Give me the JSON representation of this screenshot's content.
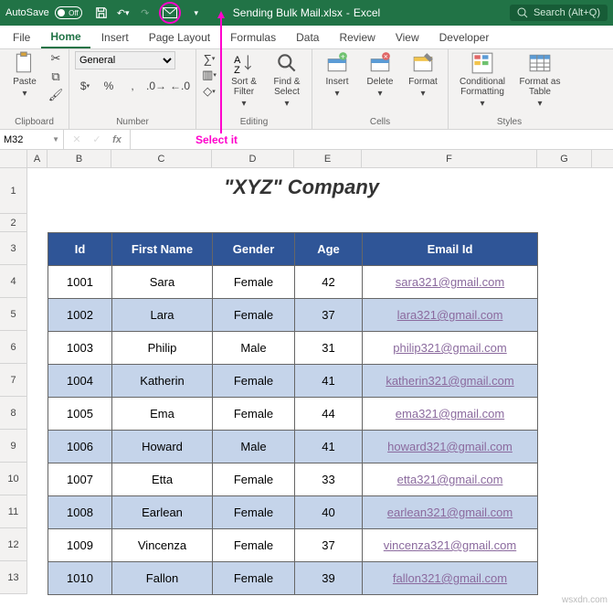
{
  "titlebar": {
    "autosave_label": "AutoSave",
    "autosave_state": "Off",
    "filename": "Sending Bulk Mail.xlsx",
    "app": "Excel",
    "search_placeholder": "Search (Alt+Q)"
  },
  "tabs": [
    "File",
    "Home",
    "Insert",
    "Page Layout",
    "Formulas",
    "Data",
    "Review",
    "View",
    "Developer"
  ],
  "active_tab": "Home",
  "ribbon": {
    "clipboard": {
      "paste": "Paste",
      "group": "Clipboard"
    },
    "number": {
      "format": "General",
      "group": "Number"
    },
    "editing": {
      "sort": "Sort & Filter",
      "find": "Find & Select",
      "group": "Editing"
    },
    "cells": {
      "insert": "Insert",
      "delete": "Delete",
      "format": "Format",
      "group": "Cells"
    },
    "styles": {
      "cond": "Conditional Formatting",
      "fmt": "Format as Table",
      "group": "Styles"
    }
  },
  "annotation": {
    "select_it": "Select it"
  },
  "namebox": "M32",
  "chart_data": {
    "type": "table",
    "title": "\"XYZ\" Company",
    "columns": [
      "Id",
      "First Name",
      "Gender",
      "Age",
      "Email Id"
    ],
    "rows": [
      {
        "id": "1001",
        "first_name": "Sara",
        "gender": "Female",
        "age": "42",
        "email": "sara321@gmail.com"
      },
      {
        "id": "1002",
        "first_name": "Lara",
        "gender": "Female",
        "age": "37",
        "email": "lara321@gmail.com"
      },
      {
        "id": "1003",
        "first_name": "Philip",
        "gender": "Male",
        "age": "31",
        "email": "philip321@gmail.com"
      },
      {
        "id": "1004",
        "first_name": "Katherin",
        "gender": "Female",
        "age": "41",
        "email": "katherin321@gmail.com"
      },
      {
        "id": "1005",
        "first_name": "Ema",
        "gender": "Female",
        "age": "44",
        "email": "ema321@gmail.com"
      },
      {
        "id": "1006",
        "first_name": "Howard",
        "gender": "Male",
        "age": "41",
        "email": "howard321@gmail.com"
      },
      {
        "id": "1007",
        "first_name": "Etta",
        "gender": "Female",
        "age": "33",
        "email": "etta321@gmail.com"
      },
      {
        "id": "1008",
        "first_name": "Earlean",
        "gender": "Female",
        "age": "40",
        "email": "earlean321@gmail.com"
      },
      {
        "id": "1009",
        "first_name": "Vincenza",
        "gender": "Female",
        "age": "37",
        "email": "vincenza321@gmail.com"
      },
      {
        "id": "1010",
        "first_name": "Fallon",
        "gender": "Female",
        "age": "39",
        "email": "fallon321@gmail.com"
      }
    ]
  },
  "watermark": "wsxdn.com"
}
